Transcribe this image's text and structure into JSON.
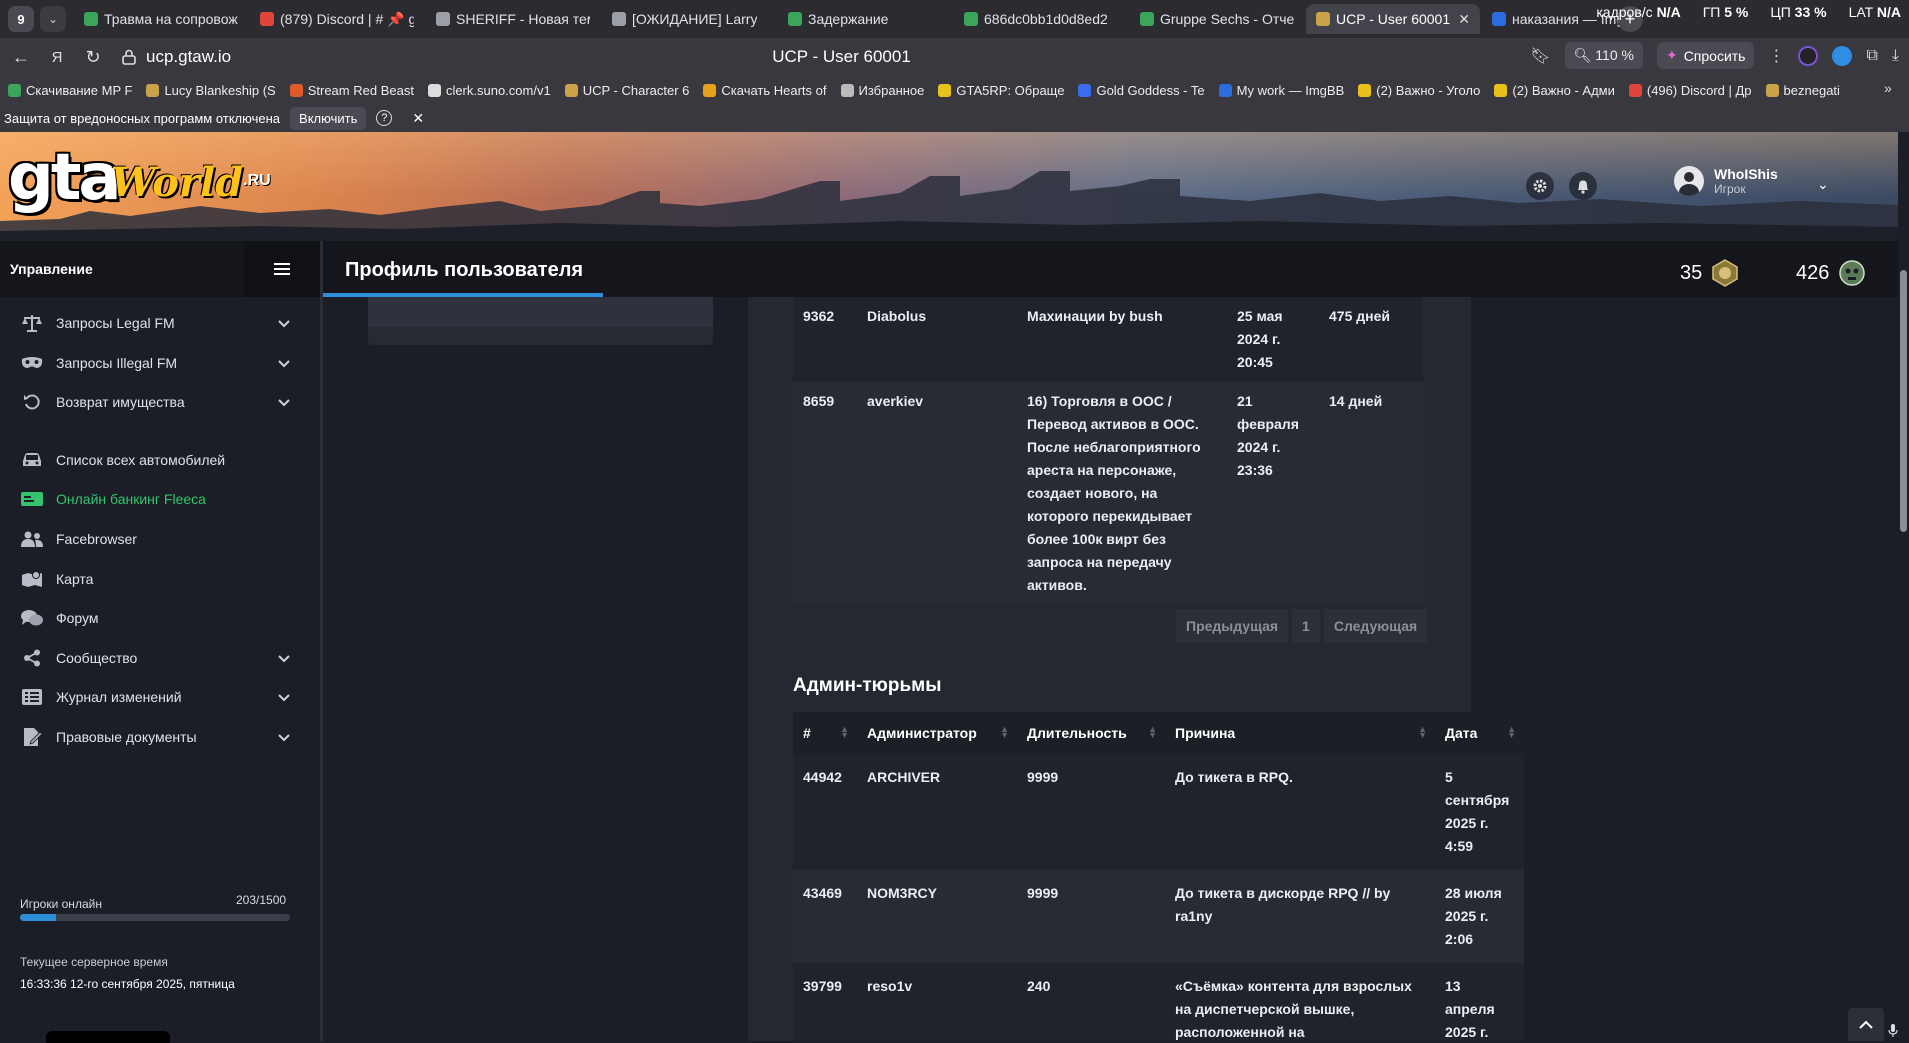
{
  "browser": {
    "tab_count": "9",
    "tabs": [
      {
        "label": "Травма на сопровож",
        "color": "#3ba55c"
      },
      {
        "label": "(879) Discord | # 📌 g",
        "color": "#e0453a"
      },
      {
        "label": "SHERIFF - Новая тем",
        "color": "#9aa0a6"
      },
      {
        "label": "[ОЖИДАНИЕ] Larry",
        "color": "#9aa0a6"
      },
      {
        "label": "Задержание",
        "color": "#3ba55c"
      },
      {
        "label": "686dc0bb1d0d8ed2",
        "color": "#3ba55c"
      },
      {
        "label": "Gruppe Sechs - Отче",
        "color": "#3ba55c"
      },
      {
        "label": "UCP - User 60001",
        "color": "#c9a24a",
        "active": true
      },
      {
        "label": "наказания — ImgBB",
        "color": "#2d6cdf"
      }
    ],
    "stats": [
      {
        "label": "кадров/с",
        "value": "N/A"
      },
      {
        "label": "ГП",
        "value": "5 %"
      },
      {
        "label": "ЦП",
        "value": "33 %"
      },
      {
        "label": "LAT",
        "value": "N/A"
      }
    ],
    "url": "ucp.gtaw.io",
    "page_title": "UCP - User 60001",
    "zoom": "110 %",
    "ask_label": "Спросить",
    "bookmarks": [
      {
        "label": "Скачивание MP F",
        "color": "#3ba55c"
      },
      {
        "label": "Lucy Blankeship (S",
        "color": "#c9a24a"
      },
      {
        "label": "Stream Red Beast",
        "color": "#e05a2a"
      },
      {
        "label": "clerk.suno.com/v1",
        "color": "#dddddd"
      },
      {
        "label": "UCP - Character 6",
        "color": "#c9a24a"
      },
      {
        "label": "Скачать Hearts of",
        "color": "#e8a21a"
      },
      {
        "label": "Избранное",
        "color": "#bbbbbb"
      },
      {
        "label": "GTA5RP: Обраще",
        "color": "#e8c21a"
      },
      {
        "label": "Gold Goddess - Te",
        "color": "#3b6cf0"
      },
      {
        "label": "My work — ImgBB",
        "color": "#2d6cdf"
      },
      {
        "label": "(2) Важно - Уголо",
        "color": "#e8c21a"
      },
      {
        "label": "(2) Важно - Адми",
        "color": "#e8c21a"
      },
      {
        "label": "(496) Discord | Др",
        "color": "#e0453a"
      },
      {
        "label": "beznegati",
        "color": "#c9a24a"
      }
    ],
    "warning_text": "Защита от вредоносных программ отключена",
    "warning_button": "Включить"
  },
  "header": {
    "logo_gta": "gta",
    "logo_world": "World",
    "logo_ru": ".RU",
    "user_name": "WhoIShis",
    "user_role": "Игрок"
  },
  "sidebar": {
    "title": "Управление",
    "items": [
      {
        "label": "Запросы Legal FM",
        "icon": "scales-icon",
        "chevron": true
      },
      {
        "label": "Запросы Illegal FM",
        "icon": "mask-icon",
        "chevron": true
      },
      {
        "label": "Возврат имущества",
        "icon": "undo-icon",
        "chevron": true
      },
      {
        "label": "Список всех автомобилей",
        "icon": "car-icon",
        "chevron": false
      },
      {
        "label": "Онлайн банкинг Fleeca",
        "icon": "money-icon",
        "chevron": false,
        "active": true
      },
      {
        "label": "Facebrowser",
        "icon": "users-icon",
        "chevron": false
      },
      {
        "label": "Карта",
        "icon": "map-icon",
        "chevron": false
      },
      {
        "label": "Форум",
        "icon": "comments-icon",
        "chevron": false
      },
      {
        "label": "Сообщество",
        "icon": "share-icon",
        "chevron": true
      },
      {
        "label": "Журнал изменений",
        "icon": "list-icon",
        "chevron": true
      },
      {
        "label": "Правовые документы",
        "icon": "document-icon",
        "chevron": true
      }
    ],
    "online_label": "Игроки онлайн",
    "online_count": "203/1500",
    "online_fraction": 0.135,
    "time_label": "Текущее серверное время",
    "time_value": "16:33:36 12-го сентября 2025, пятница"
  },
  "titlebar": {
    "title": "Профиль пользователя",
    "stat1": "35",
    "stat2": "426"
  },
  "warnings_table": {
    "rows": [
      {
        "id": "9362",
        "admin": "Diabolus",
        "reason": "Махинации by bush",
        "date": "25 мая 2024 г. 20:45",
        "duration": "475 дней"
      },
      {
        "id": "8659",
        "admin": "averkiev",
        "reason": "16) Торговля в ООС / Перевод активов в ООС. После неблагоприятного ареста на персонаже, создает нового, на которого перекидывает более 100к вирт без запроса на передачу активов.",
        "date": "21 февраля 2024 г. 23:36",
        "duration": "14 дней"
      }
    ],
    "pager": {
      "prev": "Предыдущая",
      "page": "1",
      "next": "Следующая"
    }
  },
  "jails": {
    "title": "Админ-тюрьмы",
    "headers": [
      "#",
      "Администратор",
      "Длительность",
      "Причина",
      "Дата"
    ],
    "rows": [
      {
        "id": "44942",
        "admin": "ARCHIVER",
        "duration": "9999",
        "reason": "До тикета в RPQ.",
        "date": "5 сентября 2025 г. 4:59"
      },
      {
        "id": "43469",
        "admin": "NOM3RCY",
        "duration": "9999",
        "reason": "До тикета в дискорде RPQ // by ra1ny",
        "date": "28 июля 2025 г. 2:06"
      },
      {
        "id": "39799",
        "admin": "reso1v",
        "duration": "240",
        "reason": "«Съёмка» контента для взрослых на диспетчерской вышке, расположенной на",
        "date": "13 апреля 2025 г."
      }
    ]
  }
}
